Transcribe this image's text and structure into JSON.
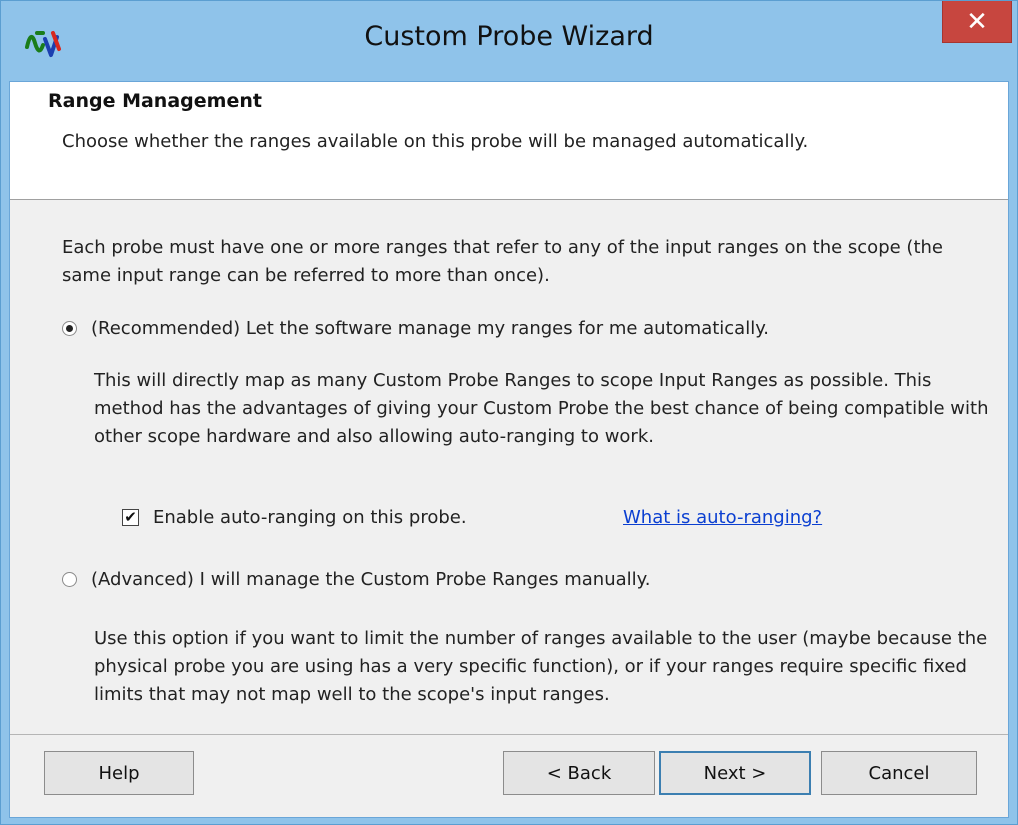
{
  "window": {
    "title": "Custom Probe Wizard",
    "close_glyph": "✕",
    "app_icon": "waveform-probe-icon"
  },
  "header": {
    "title": "Range Management",
    "description": "Choose whether the ranges available on this probe will be managed automatically."
  },
  "body": {
    "intro": "Each probe must have one or more ranges that refer to any of the input ranges on the scope (the same input range can be referred to more than once).",
    "options": [
      {
        "label": "(Recommended) Let the software manage my ranges for me automatically.",
        "selected": true,
        "description": "This will directly map as many Custom Probe Ranges to scope Input Ranges as possible. This method has the advantages of giving your Custom Probe the best chance of being compatible with other scope hardware and also allowing auto-ranging to work."
      },
      {
        "label": "(Advanced) I will manage the Custom Probe Ranges manually.",
        "selected": false,
        "description": "Use this option if you want to limit the number of ranges available to the user (maybe because the physical probe you are using has a very specific function), or if your ranges require specific fixed limits that may not map well to the scope's input ranges."
      }
    ],
    "auto_ranging_checkbox": {
      "label": "Enable auto-ranging on this probe.",
      "checked": true,
      "check_glyph": "✔"
    },
    "help_link": "What is auto-ranging?"
  },
  "footer": {
    "help": "Help",
    "back": "< Back",
    "next": "Next >",
    "cancel": "Cancel"
  },
  "colors": {
    "title_bar": "#8fc3ea",
    "close_button": "#c7463f",
    "link": "#0b3fd1",
    "default_button_border": "#3c7fb1"
  }
}
